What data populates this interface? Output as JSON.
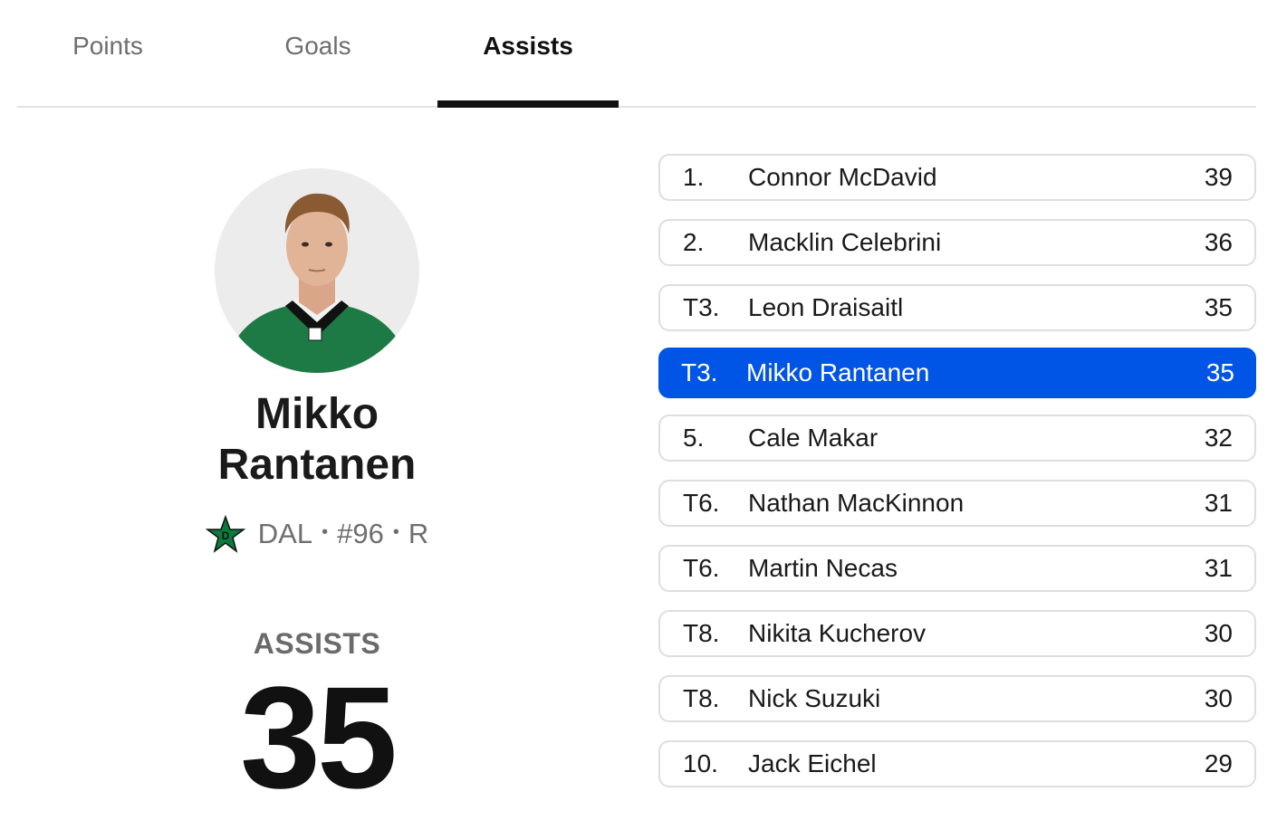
{
  "tabs": [
    {
      "label": "Points",
      "active": false
    },
    {
      "label": "Goals",
      "active": false
    },
    {
      "label": "Assists",
      "active": true
    }
  ],
  "player": {
    "first_name": "Mikko",
    "last_name": "Rantanen",
    "team": "DAL",
    "number": "#96",
    "position": "R",
    "separator": "•",
    "team_logo_icon": "dallas-stars-logo",
    "jersey_color": "#1e7a45",
    "stat_label": "ASSISTS",
    "stat_value": "35"
  },
  "leaderboard": [
    {
      "rank": "1.",
      "name": "Connor McDavid",
      "value": "39",
      "highlighted": false
    },
    {
      "rank": "2.",
      "name": "Macklin Celebrini",
      "value": "36",
      "highlighted": false
    },
    {
      "rank": "T3.",
      "name": "Leon Draisaitl",
      "value": "35",
      "highlighted": false
    },
    {
      "rank": "T3.",
      "name": "Mikko Rantanen",
      "value": "35",
      "highlighted": true
    },
    {
      "rank": "5.",
      "name": "Cale Makar",
      "value": "32",
      "highlighted": false
    },
    {
      "rank": "T6.",
      "name": "Nathan MacKinnon",
      "value": "31",
      "highlighted": false
    },
    {
      "rank": "T6.",
      "name": "Martin Necas",
      "value": "31",
      "highlighted": false
    },
    {
      "rank": "T8.",
      "name": "Nikita Kucherov",
      "value": "30",
      "highlighted": false
    },
    {
      "rank": "T8.",
      "name": "Nick Suzuki",
      "value": "30",
      "highlighted": false
    },
    {
      "rank": "10.",
      "name": "Jack Eichel",
      "value": "29",
      "highlighted": false
    }
  ],
  "colors": {
    "highlight": "#0055e6",
    "active_tab_underline": "#111111",
    "muted_text": "#6e6e6e"
  }
}
